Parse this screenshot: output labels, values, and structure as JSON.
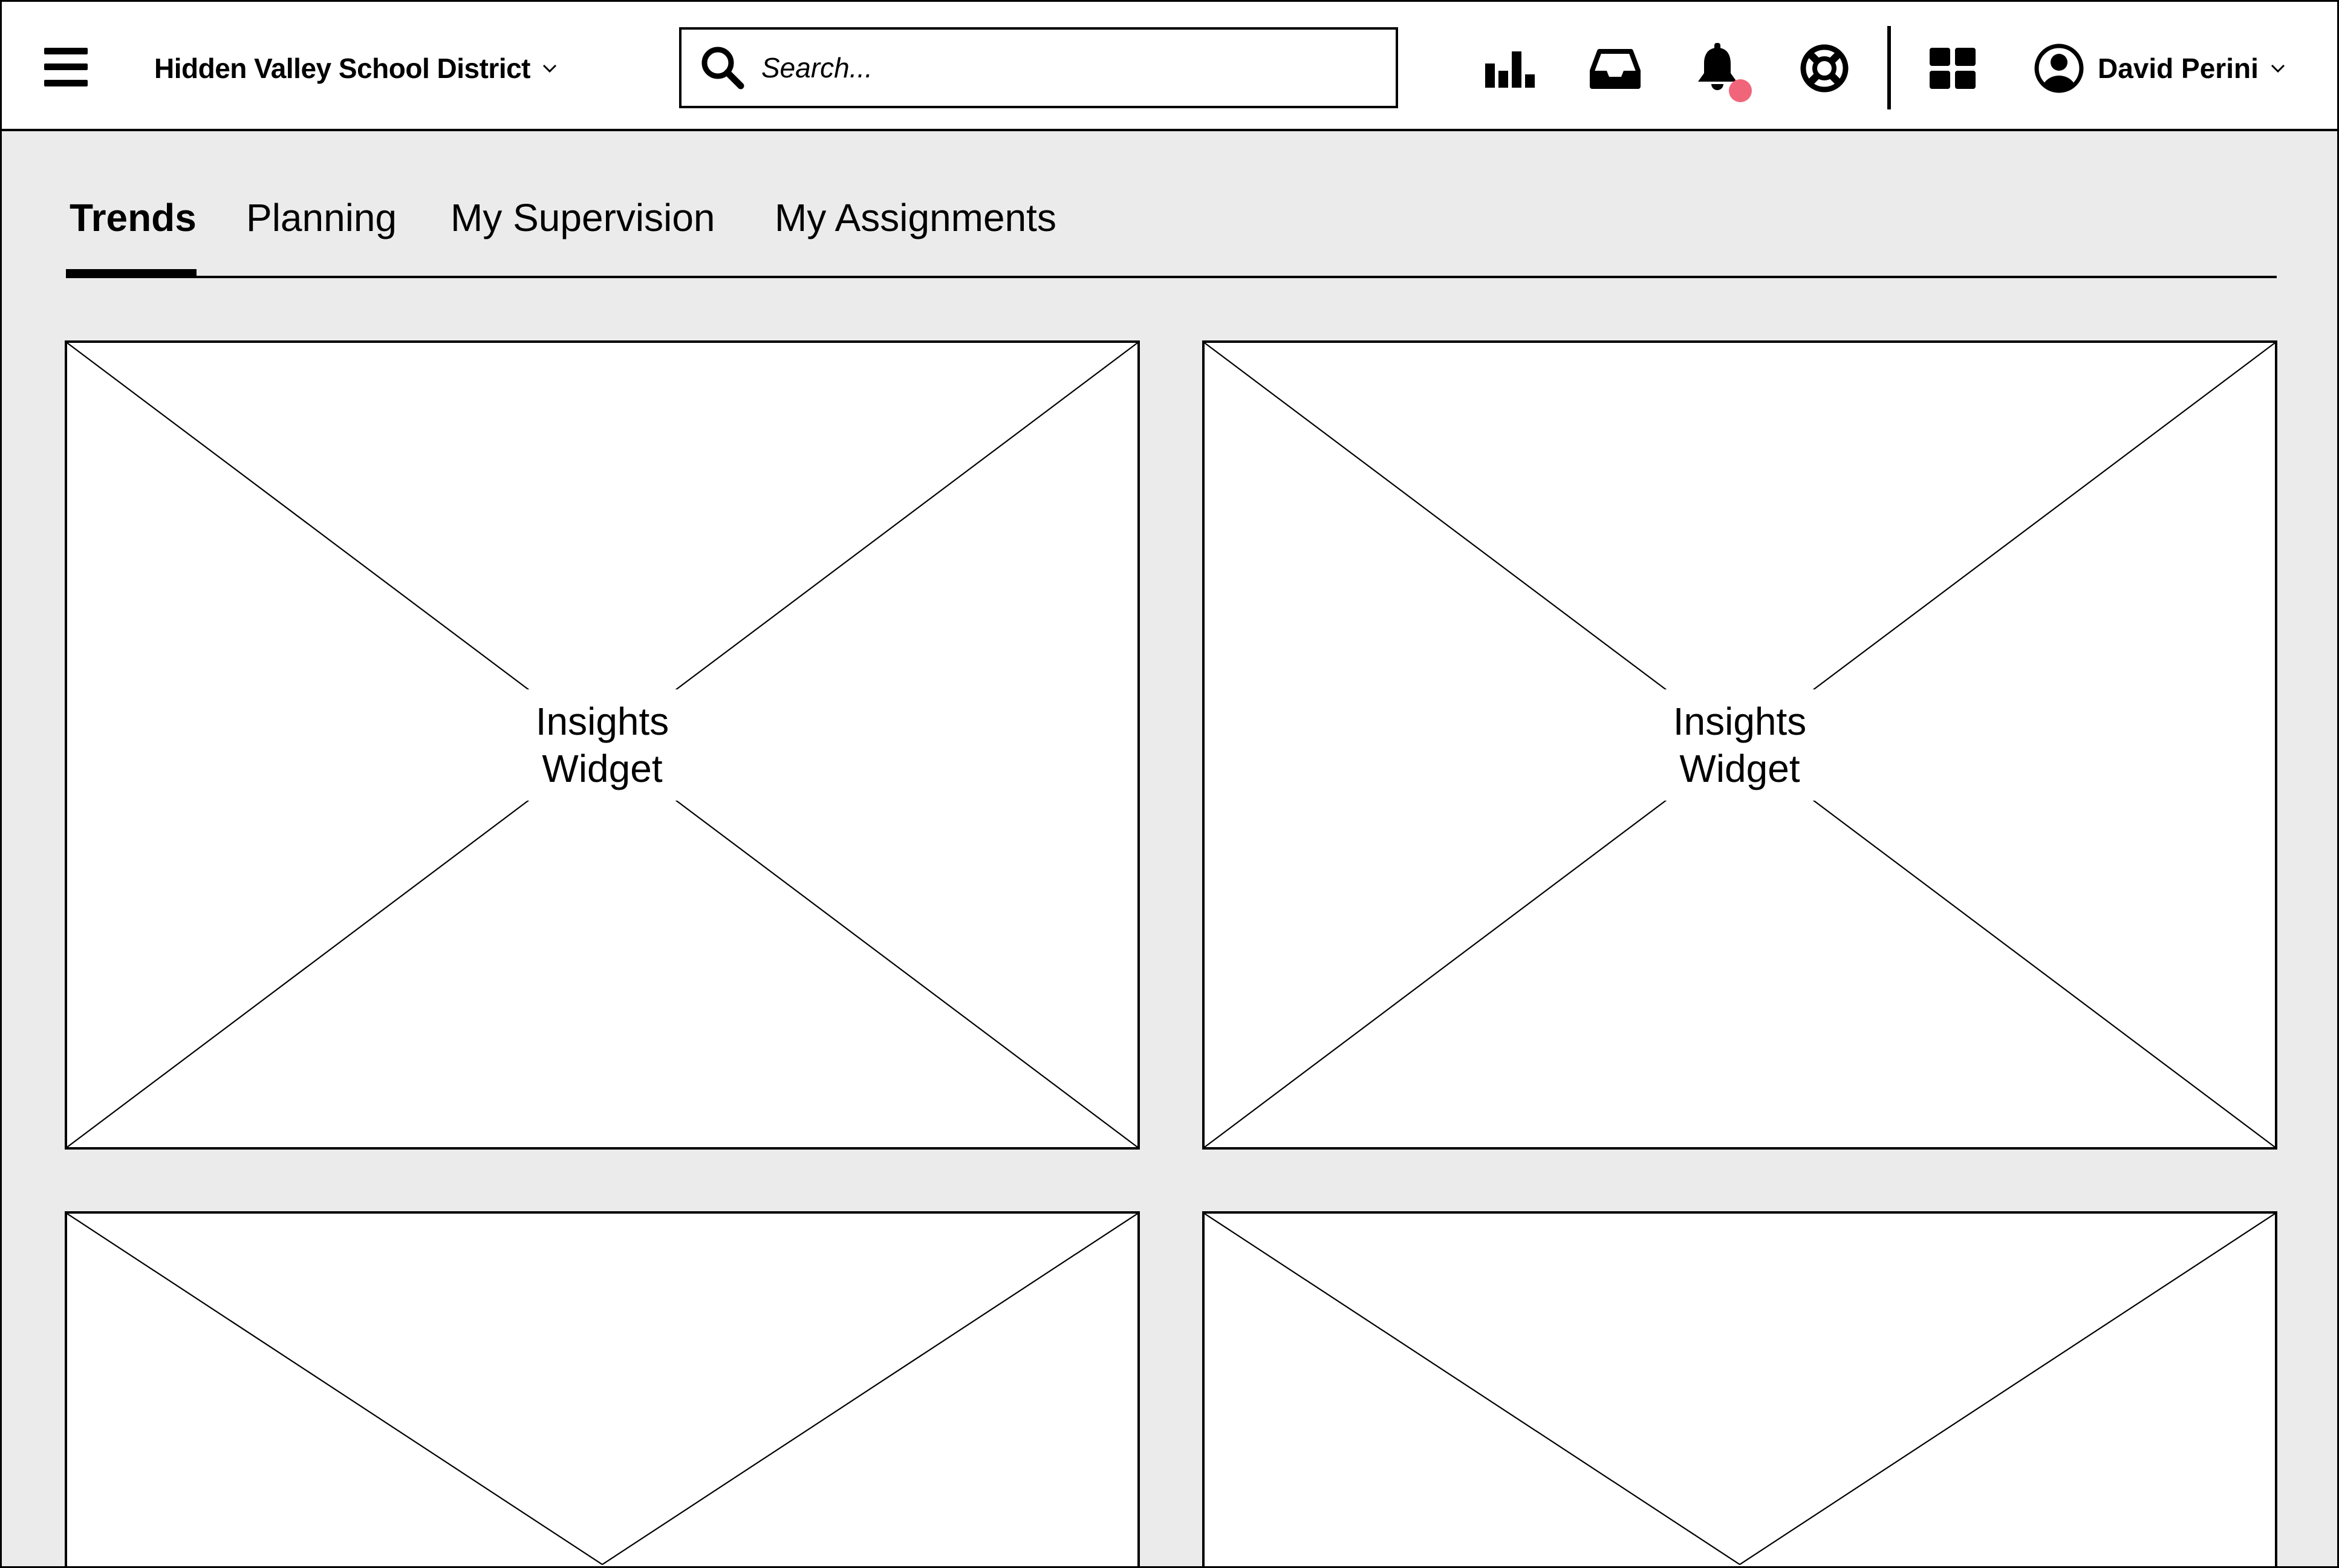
{
  "header": {
    "org_name": "Hidden Valley School District",
    "search": {
      "placeholder": "Search...",
      "value": ""
    },
    "icons": [
      "menu-icon",
      "chevron-down-icon",
      "search-icon",
      "bar-chart-icon",
      "inbox-icon",
      "bell-icon",
      "lifebuoy-icon",
      "apps-grid-icon",
      "user-avatar-icon"
    ],
    "user_name": "David Perini",
    "notification_color": "#f0657a"
  },
  "tabs": [
    {
      "label": "Trends",
      "active": true
    },
    {
      "label": "Planning",
      "active": false
    },
    {
      "label": "My Supervision",
      "active": false
    },
    {
      "label": "My Assignments",
      "active": false
    }
  ],
  "widgets": [
    {
      "label": "Insights\nWidget"
    },
    {
      "label": "Insights\nWidget"
    },
    {
      "label": ""
    },
    {
      "label": ""
    }
  ],
  "colors": {
    "background": "#ebebeb",
    "surface": "#ffffff",
    "stroke": "#000000"
  }
}
